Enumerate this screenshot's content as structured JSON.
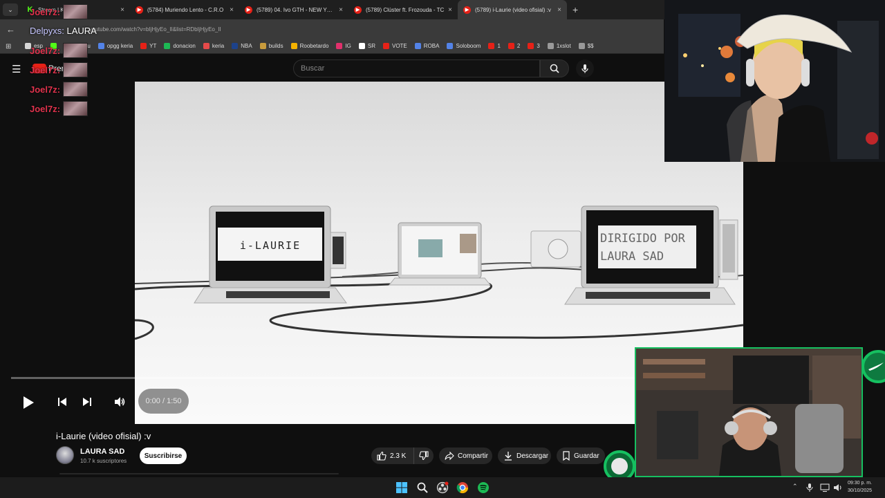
{
  "browser": {
    "tab_menu_glyph": "⌄",
    "tabs": [
      {
        "favicon": "kick",
        "title": "Stream | Kick",
        "close": "×",
        "active": false
      },
      {
        "favicon": "youtube",
        "title": "(5784) Muriendo Lento - C.R.O",
        "close": "×",
        "active": false
      },
      {
        "favicon": "youtube",
        "title": "(5789) 04. Ivo GTH - NEW YORK",
        "close": "×",
        "active": false
      },
      {
        "favicon": "youtube",
        "title": "(5789) Clúster ft. Frozouda - TC",
        "close": "×",
        "active": false
      },
      {
        "favicon": "youtube",
        "title": "(5789) i-Laurie (video ofisial) :v",
        "close": "×",
        "active": true
      }
    ],
    "new_tab": "+",
    "back_glyph": "←",
    "url": "youtube.com/watch?v=bIjHjyEo_II&list=RDbIjHjyEo_II",
    "bookmarks": [
      {
        "label": "esp",
        "color": "#d6d6d6"
      },
      {
        "label": "",
        "color": "#53fc18"
      },
      {
        "label": "coscu",
        "color": "#53fc18"
      },
      {
        "label": "opgg keria",
        "color": "#5383e8"
      },
      {
        "label": "YT",
        "color": "#e62117"
      },
      {
        "label": "donacion",
        "color": "#1db954"
      },
      {
        "label": "keria",
        "color": "#e64a4a"
      },
      {
        "label": "NBA",
        "color": "#1d428a"
      },
      {
        "label": "builds",
        "color": "#c89b3c"
      },
      {
        "label": "Roobetardo",
        "color": "#f5b300"
      },
      {
        "label": "IG",
        "color": "#e1306c"
      },
      {
        "label": "SR",
        "color": "#ffffff"
      },
      {
        "label": "VOTE",
        "color": "#e62117"
      },
      {
        "label": "ROBA",
        "color": "#5383e8"
      },
      {
        "label": "Soloboom",
        "color": "#5383e8"
      },
      {
        "label": "1",
        "color": "#e62117"
      },
      {
        "label": "2",
        "color": "#e62117"
      },
      {
        "label": "3",
        "color": "#e62117"
      },
      {
        "label": "1xslot",
        "color": "#999999"
      },
      {
        "label": "$$",
        "color": "#999999"
      }
    ]
  },
  "youtube": {
    "hamburger": "☰",
    "logo_text": "Prem",
    "search_placeholder": "Buscar",
    "video": {
      "title": "i-Laurie (video ofisial) :v",
      "screen_text_left": "i-LAURIE",
      "screen_text_right_1": "DIRIGIDO POR",
      "screen_text_right_2": "LAURA SAD",
      "current_time": "0:00 / 1:50"
    },
    "channel": {
      "name": "LAURA SAD",
      "subscribers": "10.7 k suscriptores",
      "subscribe_label": "Suscribirse"
    },
    "actions": {
      "likes": "2.3 K",
      "share": "Compartir",
      "download": "Descargar",
      "save": "Guardar"
    }
  },
  "chat": {
    "highlight_user": "Delpyxs:",
    "highlight_text": " LAURA",
    "lines": [
      {
        "user": "Joel7z:"
      },
      {
        "user": "Joel7z:"
      },
      {
        "user": "Joel7z:"
      },
      {
        "user": "Joel7z:"
      },
      {
        "user": "Joel7z:"
      },
      {
        "user": "Joel7z:"
      }
    ]
  },
  "taskbar": {
    "clock_time": "09:30 p. m.",
    "clock_date": "30/10/2025",
    "tray_chevron": "⌃"
  },
  "colors": {
    "chat_user": "#e0334d",
    "accent_green": "#16c060",
    "youtube_red": "#e62117"
  }
}
